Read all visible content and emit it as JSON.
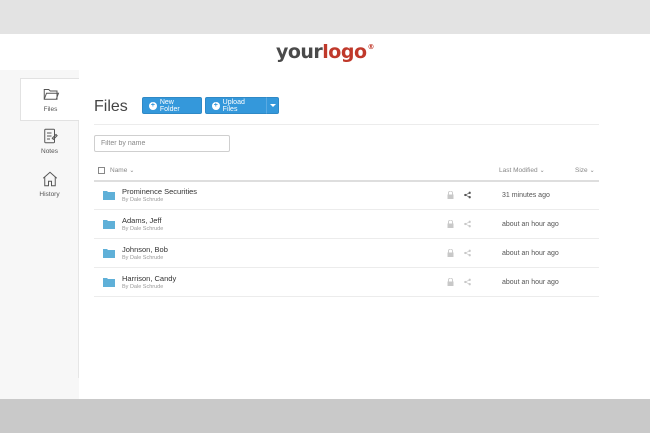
{
  "logo": {
    "your": "your",
    "logo": "logo",
    "reg": "®"
  },
  "sidebar": {
    "items": [
      {
        "label": "Files",
        "icon": "folder-open-icon",
        "active": true
      },
      {
        "label": "Notes",
        "icon": "notes-icon",
        "active": false
      },
      {
        "label": "History",
        "icon": "home-icon",
        "active": false
      }
    ]
  },
  "main": {
    "title": "Files",
    "new_folder_label": "New Folder",
    "upload_files_label": "Upload Files",
    "filter_placeholder": "Filter by name",
    "columns": {
      "name": "Name",
      "last_modified": "Last Modified",
      "size": "Size"
    },
    "rows": [
      {
        "name": "Prominence Securities",
        "by": "By Dale Schrude",
        "modified": "31 minutes ago",
        "shared": true
      },
      {
        "name": "Adams, Jeff",
        "by": "By Dale Schrude",
        "modified": "about an hour ago",
        "shared": false
      },
      {
        "name": "Johnson, Bob",
        "by": "By Dale Schrude",
        "modified": "about an hour ago",
        "shared": false
      },
      {
        "name": "Harrison, Candy",
        "by": "By Dale Schrude",
        "modified": "about an hour ago",
        "shared": false
      }
    ]
  },
  "colors": {
    "accent": "#3498db",
    "folder": "#5fb0d8",
    "logo_red": "#c0392b"
  }
}
